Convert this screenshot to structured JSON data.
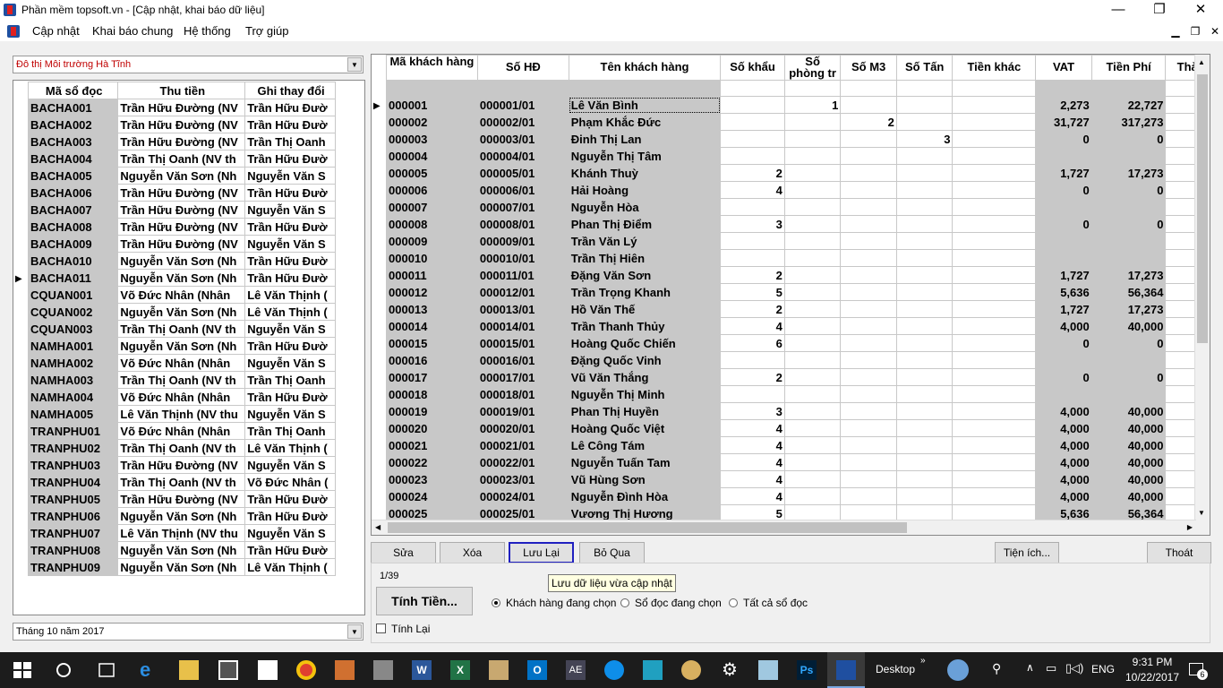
{
  "window": {
    "title": "Phần mềm topsoft.vn - [Cập nhật, khai báo dữ liệu]"
  },
  "menu": [
    "Cập nhật",
    "Khai báo chung",
    "Hệ thống",
    "Trợ giúp"
  ],
  "area_combo": "Đô thị Môi trường Hà Tĩnh",
  "month_combo": "Tháng 10 năm 2017",
  "left_table": {
    "headers": [
      "Mã sổ đọc",
      "Thu tiền",
      "Ghi thay đổi"
    ],
    "rows": [
      [
        "BACHA001",
        "Trần Hữu Đường (NV",
        "Trần Hữu Đườ"
      ],
      [
        "BACHA002",
        "Trần Hữu Đường (NV",
        "Trần Hữu Đườ"
      ],
      [
        "BACHA003",
        "Trần Hữu Đường (NV",
        "Trần Thị Oanh"
      ],
      [
        "BACHA004",
        "Trần Thị Oanh (NV th",
        "Trần Hữu Đườ"
      ],
      [
        "BACHA005",
        "Nguyễn Văn Sơn (Nh",
        "Nguyễn Văn S"
      ],
      [
        "BACHA006",
        "Trần Hữu Đường (NV",
        "Trần Hữu Đườ"
      ],
      [
        "BACHA007",
        "Trần Hữu Đường (NV",
        "Nguyễn Văn S"
      ],
      [
        "BACHA008",
        "Trần Hữu Đường (NV",
        "Trần Hữu Đườ"
      ],
      [
        "BACHA009",
        "Trần Hữu Đường (NV",
        "Nguyễn Văn S"
      ],
      [
        "BACHA010",
        "Nguyễn Văn Sơn (Nh",
        "Trần Hữu Đườ"
      ],
      [
        "BACHA011",
        "Nguyễn Văn Sơn (Nh",
        "Trần Hữu Đườ"
      ],
      [
        "CQUAN001",
        "Võ Đức Nhân (Nhân",
        "Lê Văn Thịnh ("
      ],
      [
        "CQUAN002",
        "Nguyễn Văn Sơn (Nh",
        "Lê Văn Thịnh ("
      ],
      [
        "CQUAN003",
        "Trần Thị Oanh (NV th",
        "Nguyễn Văn S"
      ],
      [
        "NAMHA001",
        "Nguyễn Văn Sơn (Nh",
        "Trần Hữu Đườ"
      ],
      [
        "NAMHA002",
        "Võ Đức Nhân (Nhân",
        "Nguyễn Văn S"
      ],
      [
        "NAMHA003",
        "Trần Thị Oanh (NV th",
        "Trần Thị Oanh"
      ],
      [
        "NAMHA004",
        "Võ Đức Nhân (Nhân",
        "Trần Hữu Đườ"
      ],
      [
        "NAMHA005",
        "Lê Văn Thịnh (NV thu",
        "Nguyễn Văn S"
      ],
      [
        "TRANPHU01",
        "Võ Đức Nhân (Nhân",
        "Trần Thị Oanh"
      ],
      [
        "TRANPHU02",
        "Trần Thị Oanh (NV th",
        "Lê Văn Thịnh ("
      ],
      [
        "TRANPHU03",
        "Trần Hữu Đường (NV",
        "Nguyễn Văn S"
      ],
      [
        "TRANPHU04",
        "Trần Thị Oanh (NV th",
        "Võ Đức Nhân ("
      ],
      [
        "TRANPHU05",
        "Trần Hữu Đường (NV",
        "Trần Hữu Đườ"
      ],
      [
        "TRANPHU06",
        "Nguyễn Văn Sơn (Nh",
        "Trần Hữu Đườ"
      ],
      [
        "TRANPHU07",
        "Lê Văn Thịnh (NV thu",
        "Nguyễn Văn S"
      ],
      [
        "TRANPHU08",
        "Nguyễn Văn Sơn (Nh",
        "Trần Hữu Đườ"
      ],
      [
        "TRANPHU09",
        "Nguyễn Văn Sơn (Nh",
        "Lê Văn Thịnh ("
      ]
    ],
    "current_row": 10
  },
  "right_table": {
    "headers": [
      "Mã khách hàng",
      "Số HĐ",
      "Tên khách hàng",
      "Số khẩu",
      "Số phòng tr",
      "Số M3",
      "Số Tấn",
      "Tiền khác",
      "VAT",
      "Tiền Phí",
      "Thà"
    ],
    "rows": [
      [
        "000001",
        "000001/01",
        "Lê Văn Bình",
        "",
        "1",
        "",
        "",
        "",
        "2,273",
        "22,727",
        ""
      ],
      [
        "000002",
        "000002/01",
        "Phạm Khắc Đức",
        "",
        "",
        "2",
        "",
        "",
        "31,727",
        "317,273",
        ""
      ],
      [
        "000003",
        "000003/01",
        "Đinh Thị Lan",
        "",
        "",
        "",
        "3",
        "",
        "0",
        "0",
        ""
      ],
      [
        "000004",
        "000004/01",
        "Nguyễn Thị Tâm",
        "",
        "",
        "",
        "",
        "",
        "",
        "",
        ""
      ],
      [
        "000005",
        "000005/01",
        "Khánh Thuỳ",
        "2",
        "",
        "",
        "",
        "",
        "1,727",
        "17,273",
        ""
      ],
      [
        "000006",
        "000006/01",
        "Hải Hoàng",
        "4",
        "",
        "",
        "",
        "",
        "0",
        "0",
        ""
      ],
      [
        "000007",
        "000007/01",
        "Nguyễn Hòa",
        "",
        "",
        "",
        "",
        "",
        "",
        "",
        ""
      ],
      [
        "000008",
        "000008/01",
        "Phan Thị Điểm",
        "3",
        "",
        "",
        "",
        "",
        "0",
        "0",
        ""
      ],
      [
        "000009",
        "000009/01",
        "Trần Văn Lý",
        "",
        "",
        "",
        "",
        "",
        "",
        "",
        ""
      ],
      [
        "000010",
        "000010/01",
        "Trần Thị Hiên",
        "",
        "",
        "",
        "",
        "",
        "",
        "",
        ""
      ],
      [
        "000011",
        "000011/01",
        "Đặng Văn Sơn",
        "2",
        "",
        "",
        "",
        "",
        "1,727",
        "17,273",
        ""
      ],
      [
        "000012",
        "000012/01",
        " Trần Trọng Khanh",
        "5",
        "",
        "",
        "",
        "",
        "5,636",
        "56,364",
        ""
      ],
      [
        "000013",
        "000013/01",
        "Hồ Văn Thế",
        "2",
        "",
        "",
        "",
        "",
        "1,727",
        "17,273",
        ""
      ],
      [
        "000014",
        "000014/01",
        "Trần Thanh Thủy",
        "4",
        "",
        "",
        "",
        "",
        "4,000",
        "40,000",
        ""
      ],
      [
        "000015",
        "000015/01",
        "Hoàng Quốc Chiến",
        "6",
        "",
        "",
        "",
        "",
        "0",
        "0",
        ""
      ],
      [
        "000016",
        "000016/01",
        "Đặng Quốc Vinh",
        "",
        "",
        "",
        "",
        "",
        "",
        "",
        ""
      ],
      [
        "000017",
        "000017/01",
        "Vũ Văn Thắng",
        "2",
        "",
        "",
        "",
        "",
        "0",
        "0",
        ""
      ],
      [
        "000018",
        "000018/01",
        "Nguyễn Thị Minh",
        "",
        "",
        "",
        "",
        "",
        "",
        "",
        ""
      ],
      [
        "000019",
        "000019/01",
        "Phan Thị Huyền",
        "3",
        "",
        "",
        "",
        "",
        "4,000",
        "40,000",
        ""
      ],
      [
        "000020",
        "000020/01",
        "Hoàng Quốc  Việt",
        "4",
        "",
        "",
        "",
        "",
        "4,000",
        "40,000",
        ""
      ],
      [
        "000021",
        "000021/01",
        "Lê Công Tám",
        "4",
        "",
        "",
        "",
        "",
        "4,000",
        "40,000",
        ""
      ],
      [
        "000022",
        "000022/01",
        "Nguyễn Tuấn Tam",
        "4",
        "",
        "",
        "",
        "",
        "4,000",
        "40,000",
        ""
      ],
      [
        "000023",
        "000023/01",
        "Vũ Hùng Sơn",
        "4",
        "",
        "",
        "",
        "",
        "4,000",
        "40,000",
        ""
      ],
      [
        "000024",
        "000024/01",
        "Nguyễn Đình Hòa",
        "4",
        "",
        "",
        "",
        "",
        "4,000",
        "40,000",
        ""
      ],
      [
        "000025",
        "000025/01",
        "Vương  Thị Hương",
        "5",
        "",
        "",
        "",
        "",
        "5,636",
        "56,364",
        ""
      ]
    ]
  },
  "buttons": {
    "sua": "Sửa",
    "xoa": "Xóa",
    "luu": "Lưu Lại",
    "boqua": "Bỏ Qua",
    "tienich": "Tiện ích...",
    "thoat": "Thoát",
    "tinhtien": "Tính Tiền..."
  },
  "tooltip": "Lưu dữ liệu vừa cập nhật",
  "page_counter": "1/39",
  "radios": [
    "Khách hàng đang chọn",
    "Sổ đọc đang chọn",
    "Tất cả sổ đọc"
  ],
  "recalc_label": "Tính Lại",
  "taskbar": {
    "desktop": "Desktop",
    "lang": "ENG",
    "time": "9:31 PM",
    "date": "10/22/2017",
    "notif_count": "6"
  }
}
